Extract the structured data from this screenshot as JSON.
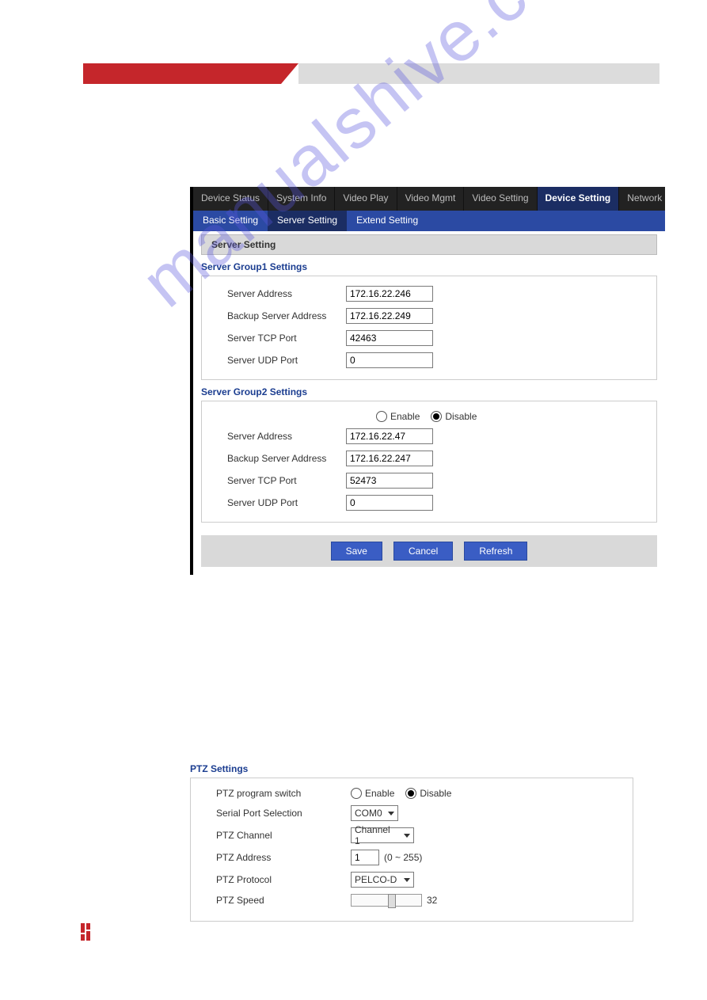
{
  "watermark": "manualshive.com",
  "topTabs": {
    "t0": "Device Status",
    "t1": "System Info",
    "t2": "Video Play",
    "t3": "Video Mgmt",
    "t4": "Video Setting",
    "t5": "Device Setting",
    "t6": "Network Setti"
  },
  "subTabs": {
    "s0": "Basic Setting",
    "s1": "Server Setting",
    "s2": "Extend Setting"
  },
  "panelHeader": "Server Setting",
  "group1": {
    "title": "Server Group1 Settings",
    "serverAddressLabel": "Server Address",
    "serverAddressValue": "172.16.22.246",
    "backupLabel": "Backup Server Address",
    "backupValue": "172.16.22.249",
    "tcpLabel": "Server TCP Port",
    "tcpValue": "42463",
    "udpLabel": "Server UDP Port",
    "udpValue": "0"
  },
  "group2": {
    "title": "Server Group2 Settings",
    "enableLabel": "Enable",
    "disableLabel": "Disable",
    "serverAddressLabel": "Server Address",
    "serverAddressValue": "172.16.22.47",
    "backupLabel": "Backup Server Address",
    "backupValue": "172.16.22.247",
    "tcpLabel": "Server TCP Port",
    "tcpValue": "52473",
    "udpLabel": "Server UDP Port",
    "udpValue": "0"
  },
  "buttons": {
    "save": "Save",
    "cancel": "Cancel",
    "refresh": "Refresh"
  },
  "ptz": {
    "title": "PTZ Settings",
    "switchLabel": "PTZ program switch",
    "enableLabel": "Enable",
    "disableLabel": "Disable",
    "serialLabel": "Serial Port Selection",
    "serialValue": "COM0",
    "channelLabel": "PTZ Channel",
    "channelValue": "Channel 1",
    "addressLabel": "PTZ Address",
    "addressValue": "1",
    "addressRange": "(0 ~ 255)",
    "protocolLabel": "PTZ Protocol",
    "protocolValue": "PELCO-D",
    "speedLabel": "PTZ Speed",
    "speedValue": "32"
  }
}
